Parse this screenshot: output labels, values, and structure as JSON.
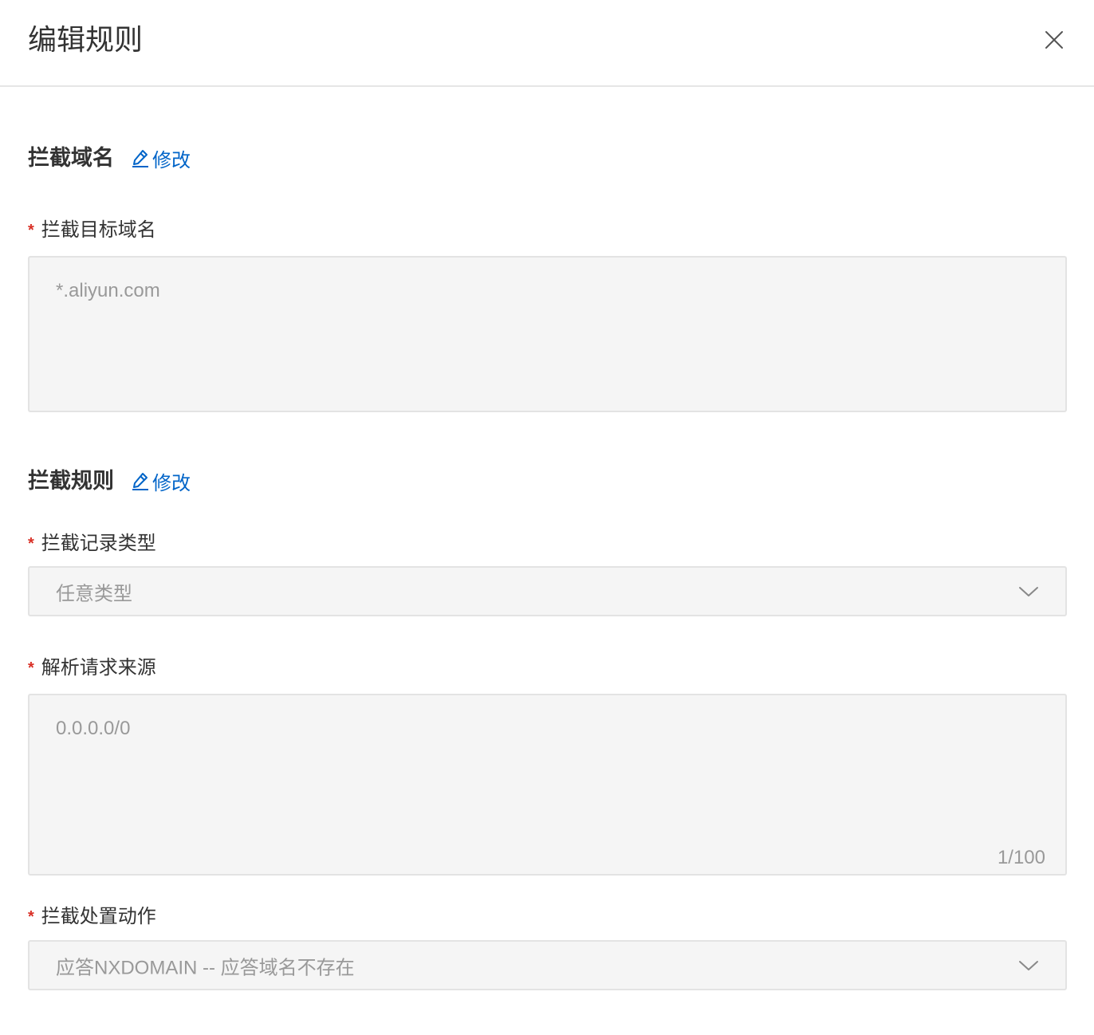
{
  "drawer": {
    "title": "编辑规则",
    "close_icon": "close-icon"
  },
  "domain_section": {
    "title": "拦截域名",
    "edit_label": "修改",
    "edit_icon": "edit-pencil-icon",
    "target_domain": {
      "label": "拦截目标域名",
      "required_mark": "*",
      "value": "*.aliyun.com"
    }
  },
  "rule_section": {
    "title": "拦截规则",
    "edit_label": "修改",
    "edit_icon": "edit-pencil-icon",
    "record_type": {
      "label": "拦截记录类型",
      "required_mark": "*",
      "value": "任意类型"
    },
    "request_source": {
      "label": "解析请求来源",
      "required_mark": "*",
      "value": "0.0.0.0/0",
      "counter": "1/100"
    },
    "action": {
      "label": "拦截处置动作",
      "required_mark": "*",
      "value": "应答NXDOMAIN -- 应答域名不存在"
    }
  },
  "colors": {
    "link": "#0064c8",
    "required": "#d93026",
    "disabled_bg": "#f5f5f5",
    "disabled_text": "#999999"
  }
}
